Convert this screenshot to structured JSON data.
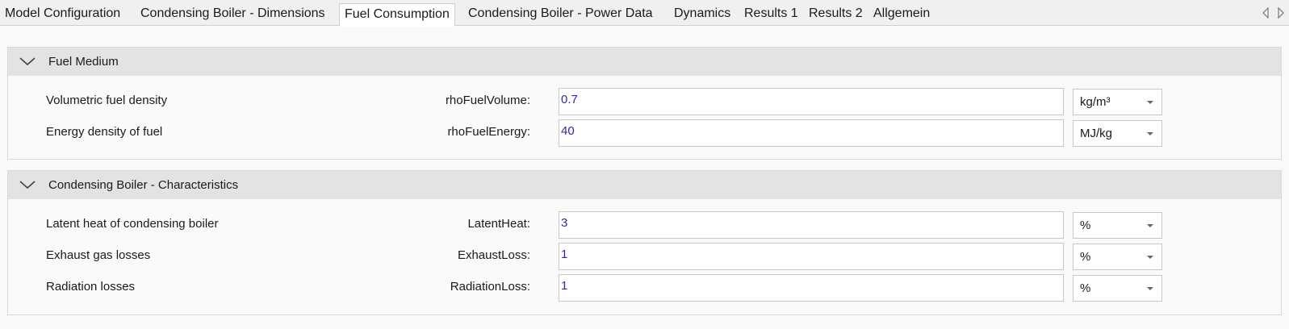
{
  "tabs": [
    {
      "label": "Model Configuration"
    },
    {
      "label": "Condensing Boiler - Dimensions"
    },
    {
      "label": "Fuel Consumption",
      "active": true
    },
    {
      "label": "Condensing Boiler - Power Data"
    },
    {
      "label": "Dynamics"
    },
    {
      "label": "Results 1"
    },
    {
      "label": "Results 2"
    },
    {
      "label": "Allgemein"
    }
  ],
  "groups": [
    {
      "title": "Fuel Medium",
      "rows": [
        {
          "description": "Volumetric fuel density",
          "param": "rhoFuelVolume:",
          "value": "0.7",
          "unit": "kg/m³"
        },
        {
          "description": "Energy density of fuel",
          "param": "rhoFuelEnergy:",
          "value": "40",
          "unit": "MJ/kg"
        }
      ]
    },
    {
      "title": "Condensing Boiler - Characteristics",
      "rows": [
        {
          "description": "Latent heat of condensing boiler",
          "param": "LatentHeat:",
          "value": "3",
          "unit": "%"
        },
        {
          "description": "Exhaust gas losses",
          "param": "ExhaustLoss:",
          "value": "1",
          "unit": "%"
        },
        {
          "description": "Radiation losses",
          "param": "RadiationLoss:",
          "value": "1",
          "unit": "%"
        }
      ]
    }
  ],
  "icons": {
    "collapse": "chevron-down-icon",
    "scroll_left": "arrow-left-icon",
    "scroll_right": "arrow-right-icon",
    "dropdown": "caret-down-icon"
  }
}
